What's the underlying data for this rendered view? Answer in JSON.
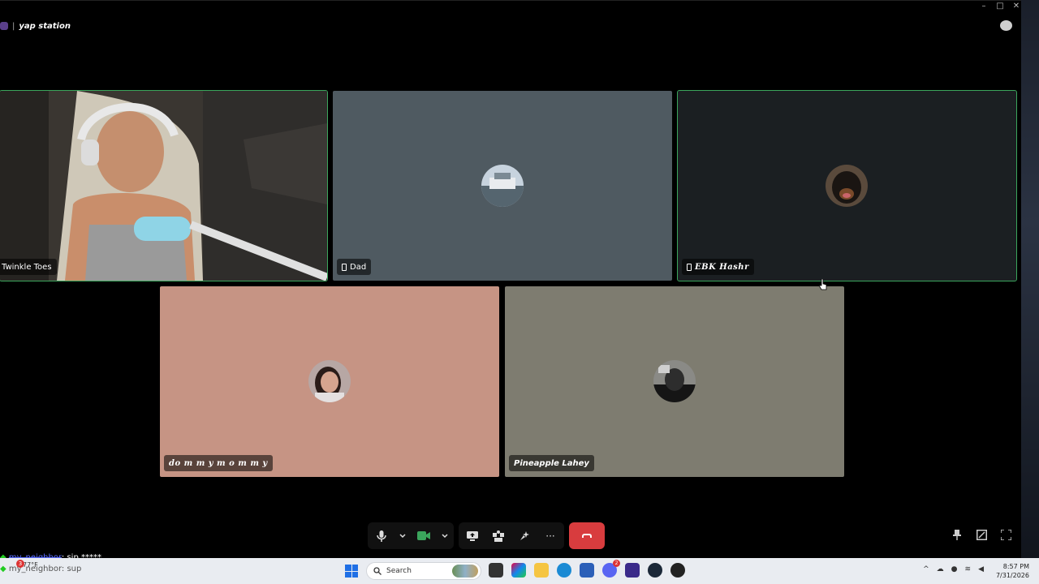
{
  "window": {
    "server_channel": "yap station",
    "separator": "|",
    "controls": [
      "–",
      "□",
      "✕"
    ]
  },
  "participants": [
    {
      "name": "Twinkle Toes",
      "speaking": true,
      "video": true,
      "mobile": false,
      "bg": "#2a2a2a"
    },
    {
      "name": "Dad",
      "speaking": false,
      "video": false,
      "mobile": true,
      "bg": "#4f5a61"
    },
    {
      "name": "EBK Hashr",
      "speaking": true,
      "video": false,
      "mobile": true,
      "bg": "#1b1f22"
    },
    {
      "name": "do m m y   m o m m y",
      "speaking": false,
      "video": false,
      "mobile": false,
      "bg": "#c69484"
    },
    {
      "name": "Pineapple Lahey",
      "speaking": false,
      "video": false,
      "mobile": false,
      "bg": "#7e7c70"
    }
  ],
  "call_controls": {
    "mic": "microphone-icon",
    "camera": "camera-icon",
    "screen_share": "screen-share-icon",
    "activities": "activities-icon",
    "soundboard": "soundboard-icon",
    "more": "···",
    "disconnect": "phone-hangup-icon"
  },
  "overlay_chat": [
    {
      "user": "my_neighbor",
      "text": ": sip *****"
    },
    {
      "user": "my_neighbor",
      "text": ": sup"
    }
  ],
  "taskbar": {
    "weather_temp": "77°F",
    "weather_badge": "3",
    "search_placeholder": "Search",
    "time": "8:57 PM",
    "date": "7/31/2026",
    "notif_badge": "2"
  },
  "colors": {
    "speaking_border": "#3ba55c",
    "hangup": "#d83c3e",
    "start_blue": "#1f6fe5"
  }
}
